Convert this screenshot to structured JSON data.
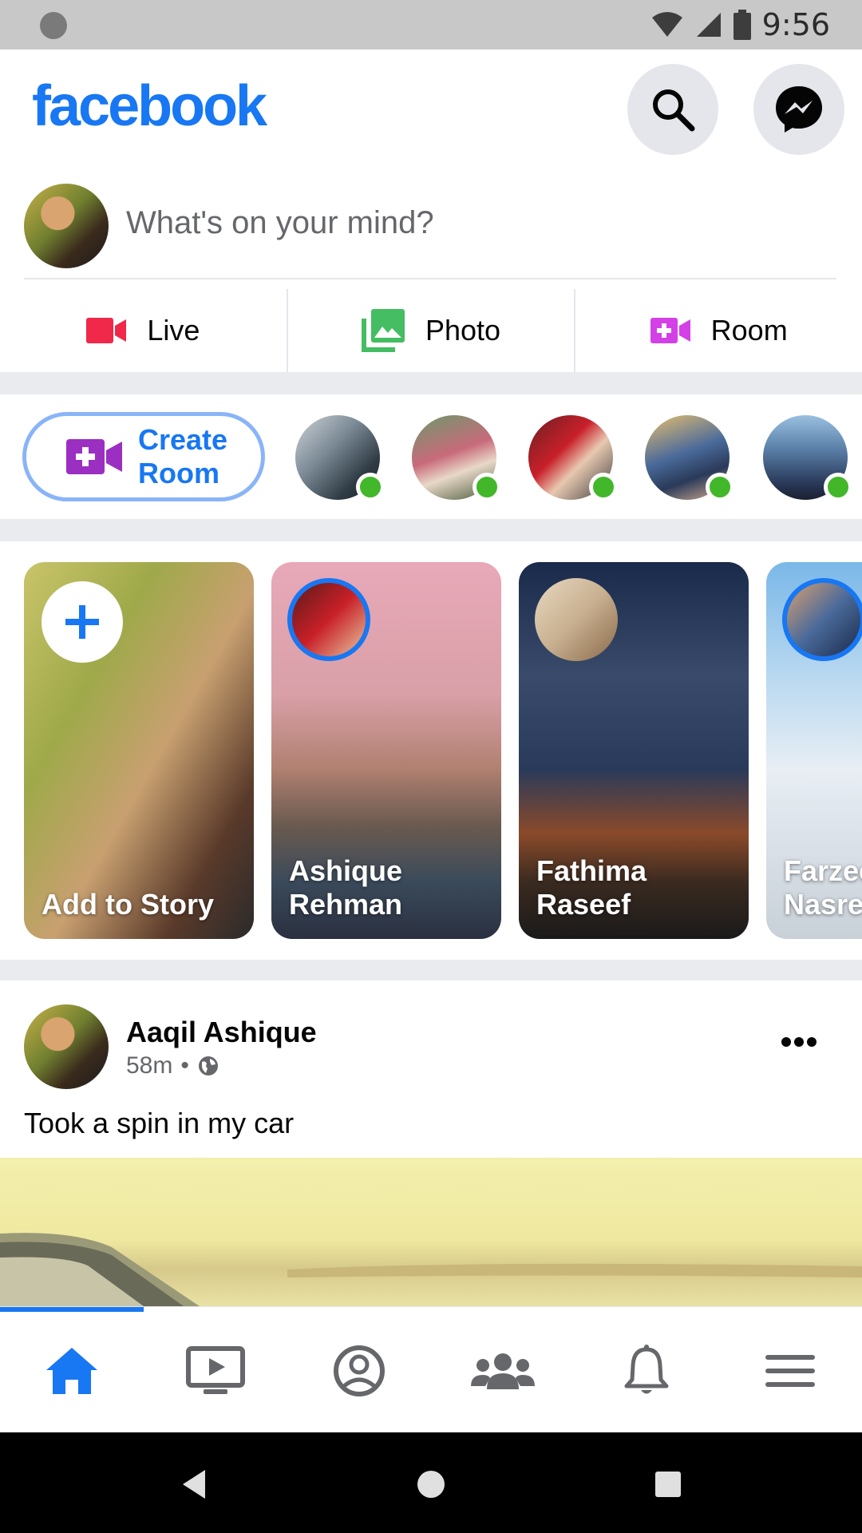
{
  "status_bar": {
    "time": "9:56"
  },
  "header": {
    "logo": "facebook",
    "search_icon": "search-icon",
    "messenger_icon": "messenger-icon"
  },
  "composer": {
    "placeholder": "What's on your mind?",
    "actions": [
      {
        "label": "Live",
        "icon": "video-camera-icon",
        "color": "#f02849"
      },
      {
        "label": "Photo",
        "icon": "photo-icon",
        "color": "#45bd62"
      },
      {
        "label": "Room",
        "icon": "room-icon",
        "color": "#d341e6"
      }
    ]
  },
  "rooms": {
    "create_label": "Create Room",
    "online_count": 5
  },
  "stories": [
    {
      "name": "Add to Story",
      "type": "add"
    },
    {
      "name": "Ashique Rehman",
      "type": "story"
    },
    {
      "name": "Fathima Raseef",
      "type": "story"
    },
    {
      "name": "Farzee Nasre",
      "type": "story"
    }
  ],
  "post": {
    "author": "Aaqil Ashique",
    "time": "58m",
    "separator": "•",
    "privacy_icon": "globe-icon",
    "text": "Took a spin in my car"
  },
  "bottom_nav": {
    "items": [
      "home-icon",
      "watch-icon",
      "profile-icon",
      "groups-icon",
      "notifications-icon",
      "menu-icon"
    ],
    "active": "home-icon"
  },
  "colors": {
    "brand": "#1877f2",
    "online": "#42b72a",
    "background": "#e9ebee"
  }
}
